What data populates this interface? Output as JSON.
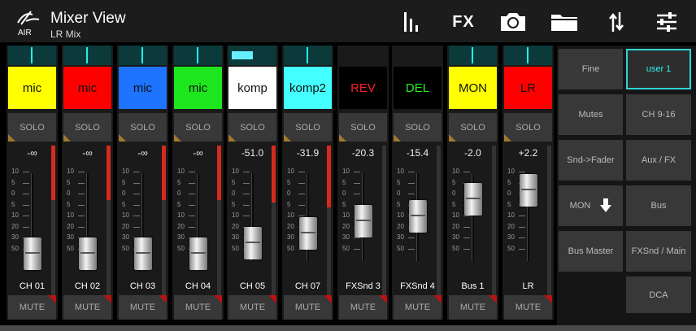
{
  "header": {
    "title": "Mixer View",
    "subtitle": "LR Mix",
    "logo_text": "AIR",
    "fx_label": "FX",
    "icons": [
      "meters-icon",
      "fx-icon",
      "camera-icon",
      "folder-icon",
      "sort-icon",
      "sliders-icon"
    ]
  },
  "channels": [
    {
      "name": "mic",
      "color": "#ffff00",
      "text_color": "#111111",
      "solo": "SOLO",
      "level": "-∞",
      "label": "CH 01",
      "mute": "MUTE",
      "fader_pos": 0.9,
      "meter": 0.35,
      "scribble": "line"
    },
    {
      "name": "mic",
      "color": "#ff0000",
      "text_color": "#111111",
      "solo": "SOLO",
      "level": "-∞",
      "label": "CH 02",
      "mute": "MUTE",
      "fader_pos": 0.9,
      "meter": 0.35,
      "scribble": "line"
    },
    {
      "name": "mic",
      "color": "#1e73ff",
      "text_color": "#111111",
      "solo": "SOLO",
      "level": "-∞",
      "label": "CH 03",
      "mute": "MUTE",
      "fader_pos": 0.9,
      "meter": 0.35,
      "scribble": "line"
    },
    {
      "name": "mic",
      "color": "#1ee61e",
      "text_color": "#111111",
      "solo": "SOLO",
      "level": "-∞",
      "label": "CH 04",
      "mute": "MUTE",
      "fader_pos": 0.9,
      "meter": 0.35,
      "scribble": "line"
    },
    {
      "name": "komp",
      "color": "#ffffff",
      "text_color": "#111111",
      "solo": "SOLO",
      "level": "-51.0",
      "label": "CH 05",
      "mute": "MUTE",
      "fader_pos": 0.77,
      "meter": 0.37,
      "scribble": "bar"
    },
    {
      "name": "komp2",
      "color": "#44ffff",
      "text_color": "#111111",
      "solo": "SOLO",
      "level": "-31.9",
      "label": "CH 07",
      "mute": "MUTE",
      "fader_pos": 0.64,
      "meter": 0.4,
      "scribble": "line"
    },
    {
      "name": "REV",
      "color": "#000000",
      "text_color": "#ff2020",
      "solo": "SOLO",
      "level": "-20.3",
      "label": "FXSnd 3",
      "mute": "MUTE",
      "fader_pos": 0.48,
      "meter": 0.0,
      "scribble": "none"
    },
    {
      "name": "DEL",
      "color": "#000000",
      "text_color": "#22ee22",
      "solo": "SOLO",
      "level": "-15.4",
      "label": "FXSnd 4",
      "mute": "MUTE",
      "fader_pos": 0.42,
      "meter": 0.0,
      "scribble": "none"
    },
    {
      "name": "MON",
      "color": "#ffff00",
      "text_color": "#111111",
      "solo": "SOLO",
      "level": "-2.0",
      "label": "Bus 1",
      "mute": "MUTE",
      "fader_pos": 0.2,
      "meter": 0.0,
      "scribble": "line"
    },
    {
      "name": "LR",
      "color": "#ff0000",
      "text_color": "#111111",
      "solo": "SOLO",
      "level": "+2.2",
      "label": "LR",
      "mute": "MUTE",
      "fader_pos": 0.08,
      "meter": 0.0,
      "scribble": "line"
    }
  ],
  "scale": [
    "10",
    "5",
    "0",
    "5",
    "10",
    "20",
    "30",
    "50"
  ],
  "right_panel": {
    "left": [
      "Fine",
      "Mutes",
      "Snd->Fader",
      "MON",
      "Bus Master"
    ],
    "right": [
      "user 1",
      "CH 9-16",
      "Aux / FX",
      "Bus",
      "FXSnd / Main",
      "DCA"
    ],
    "active": "user 1"
  },
  "colors": {
    "accent": "#2fd6d6",
    "meter_red": "#d52a1e",
    "solo_marker": "#a07a2c",
    "mute_marker": "#bb1111"
  }
}
